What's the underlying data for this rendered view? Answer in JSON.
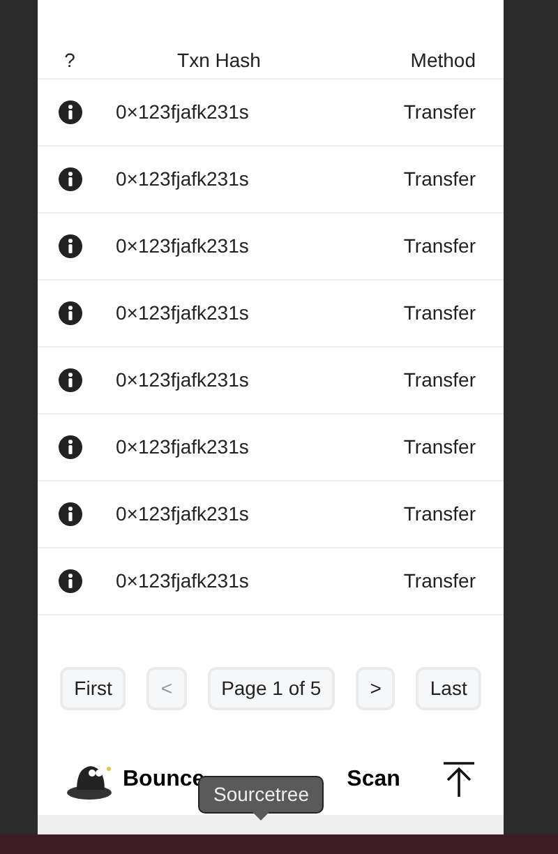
{
  "table": {
    "columns": [
      "?",
      "Txn Hash",
      "Method"
    ],
    "rows": [
      {
        "hash": "0×123fjafk231s",
        "method": "Transfer"
      },
      {
        "hash": "0×123fjafk231s",
        "method": "Transfer"
      },
      {
        "hash": "0×123fjafk231s",
        "method": "Transfer"
      },
      {
        "hash": "0×123fjafk231s",
        "method": "Transfer"
      },
      {
        "hash": "0×123fjafk231s",
        "method": "Transfer"
      },
      {
        "hash": "0×123fjafk231s",
        "method": "Transfer"
      },
      {
        "hash": "0×123fjafk231s",
        "method": "Transfer"
      },
      {
        "hash": "0×123fjafk231s",
        "method": "Transfer"
      }
    ]
  },
  "pagination": [
    {
      "label": "First",
      "disabled": false
    },
    {
      "label": "<",
      "disabled": true
    },
    {
      "label": "Page 1 of 5",
      "disabled": false
    },
    {
      "label": ">",
      "disabled": false
    },
    {
      "label": "Last",
      "disabled": false
    }
  ],
  "footer": {
    "brand_parts": [
      "Bounce",
      "Scan"
    ]
  },
  "tooltip": "Sourcetree"
}
